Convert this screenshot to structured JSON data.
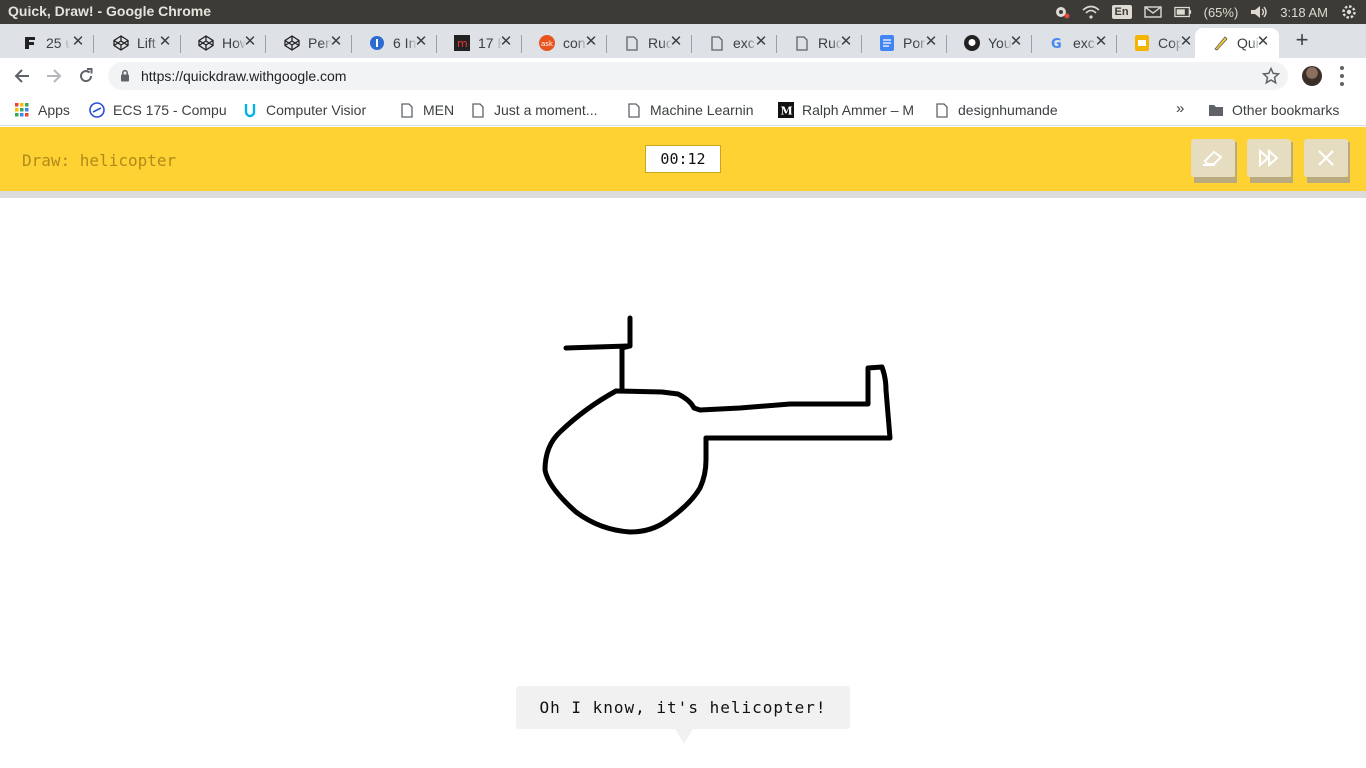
{
  "os": {
    "window_title": "Quick, Draw! - Google Chrome",
    "language": "En",
    "battery": "(65%)",
    "time": "3:18 AM"
  },
  "tabs": [
    {
      "label": "25 ui",
      "favicon": "f-logo-icon"
    },
    {
      "label": "Lift",
      "favicon": "codepen-icon"
    },
    {
      "label": "How",
      "favicon": "codepen-icon"
    },
    {
      "label": "Pen",
      "favicon": "codepen-icon"
    },
    {
      "label": "6 Inp",
      "favicon": "info-circle-icon"
    },
    {
      "label": "17 B",
      "favicon": "m-logo-icon"
    },
    {
      "label": "con",
      "favicon": "ask-logo-icon"
    },
    {
      "label": "Ruc",
      "favicon": "page-icon"
    },
    {
      "label": "exc",
      "favicon": "page-icon"
    },
    {
      "label": "Ruc",
      "favicon": "page-icon"
    },
    {
      "label": "Por",
      "favicon": "docs-icon"
    },
    {
      "label": "You",
      "favicon": "github-icon"
    },
    {
      "label": "exc",
      "favicon": "google-icon"
    },
    {
      "label": "Cop",
      "favicon": "slides-icon"
    },
    {
      "label": "Qui",
      "favicon": "quickdraw-icon",
      "active": true
    }
  ],
  "address": {
    "url": "https://quickdraw.withgoogle.com"
  },
  "bookmarks": [
    {
      "label": "Apps",
      "icon": "apps-grid-icon"
    },
    {
      "label": "ECS 175 - Compu",
      "icon": "e-logo-icon"
    },
    {
      "label": "Computer Visior",
      "icon": "udacity-icon"
    },
    {
      "label": "MEN",
      "icon": "page-icon"
    },
    {
      "label": "Just a moment...",
      "icon": "page-icon"
    },
    {
      "label": "Machine Learnin",
      "icon": "page-icon"
    },
    {
      "label": "Ralph Ammer – M",
      "icon": "medium-icon"
    },
    {
      "label": "designhumande",
      "icon": "page-icon"
    }
  ],
  "bookmarks_more": "»",
  "other_bookmarks": "Other bookmarks",
  "game": {
    "prompt": "Draw: helicopter",
    "timer": "00:12",
    "buttons": [
      "eraser-icon",
      "skip-icon",
      "close-icon"
    ],
    "guess": "Oh I know, it's helicopter!"
  },
  "colors": {
    "game_bar": "#ffd233",
    "stroke": "#000000",
    "button_face": "#e6dcbf"
  }
}
